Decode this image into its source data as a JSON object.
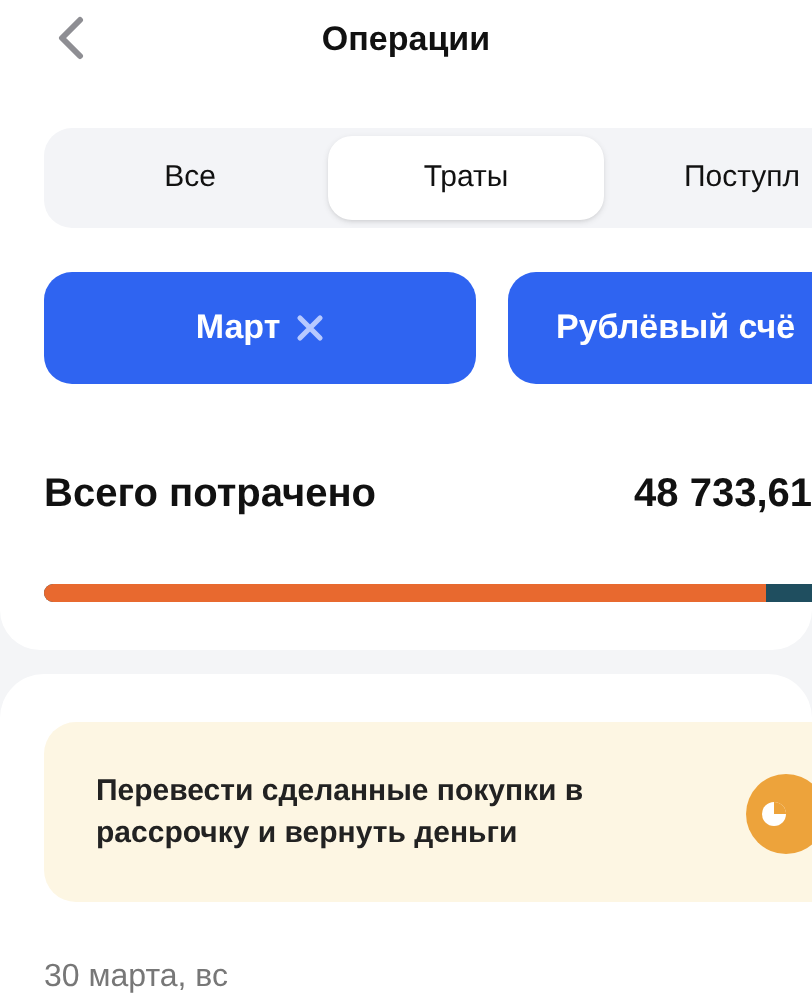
{
  "header": {
    "title": "Операции"
  },
  "tabs": [
    {
      "label": "Все",
      "selected": false
    },
    {
      "label": "Траты",
      "selected": true
    },
    {
      "label": "Поступл",
      "selected": false
    }
  ],
  "filters": [
    {
      "label": "Март",
      "removable": true
    },
    {
      "label": "Рублёвый счё",
      "removable": false
    }
  ],
  "summary": {
    "label": "Всего потрачено",
    "amount": "48 733,61",
    "level": 0.94
  },
  "promo": {
    "text": "Перевести сделанные покупки в рассрочку и вернуть деньги"
  },
  "date_heading": "30 марта, вс"
}
